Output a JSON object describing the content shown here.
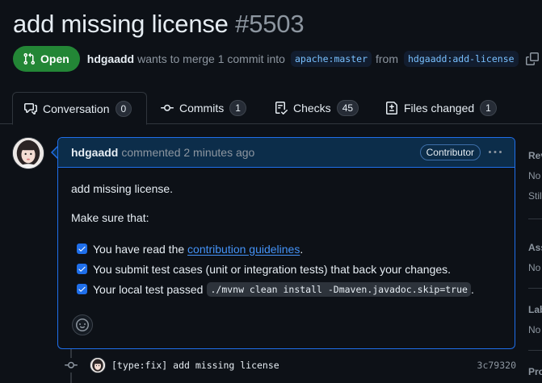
{
  "pr": {
    "title": "add missing license",
    "number": "#5503",
    "state": "Open",
    "author": "hdgaadd",
    "merge_text": "wants to merge 1 commit into",
    "base_branch": "apache:master",
    "from_text": "from",
    "head_branch": "hdgaadd:add-license"
  },
  "tabs": [
    {
      "label": "Conversation",
      "count": "0",
      "icon": "comment-discussion-icon",
      "active": true
    },
    {
      "label": "Commits",
      "count": "1",
      "icon": "git-commit-icon"
    },
    {
      "label": "Checks",
      "count": "45",
      "icon": "checklist-icon"
    },
    {
      "label": "Files changed",
      "count": "1",
      "icon": "file-diff-icon"
    }
  ],
  "comment": {
    "author": "hdgaadd",
    "action": "commented 2 minutes ago",
    "role": "Contributor",
    "intro": "add missing license.",
    "make_sure": "Make sure that:",
    "tasks": [
      {
        "before": "You have read the",
        "link": "contribution guidelines",
        "after": ".",
        "checked": true
      },
      {
        "text": "You submit test cases (unit or integration tests) that back your changes.",
        "checked": true
      },
      {
        "text": "Your local test passed",
        "code": "./mvnw clean install -Dmaven.javadoc.skip=true",
        "after": ".",
        "checked": true
      }
    ]
  },
  "commit": {
    "message": "[type:fix] add missing license",
    "sha": "3c79320"
  },
  "sidebar": {
    "reviewers_head": "Rev",
    "reviewers_val1": "No",
    "reviewers_val2": "Stil",
    "assignees_head": "Ass",
    "assignees_val": "No",
    "labels_head": "Lab",
    "labels_val": "No",
    "projects_head": "Pro"
  },
  "colors": {
    "accent": "#1f6feb",
    "open_green": "#238636",
    "link": "#4493f8",
    "background": "#0d1117"
  }
}
